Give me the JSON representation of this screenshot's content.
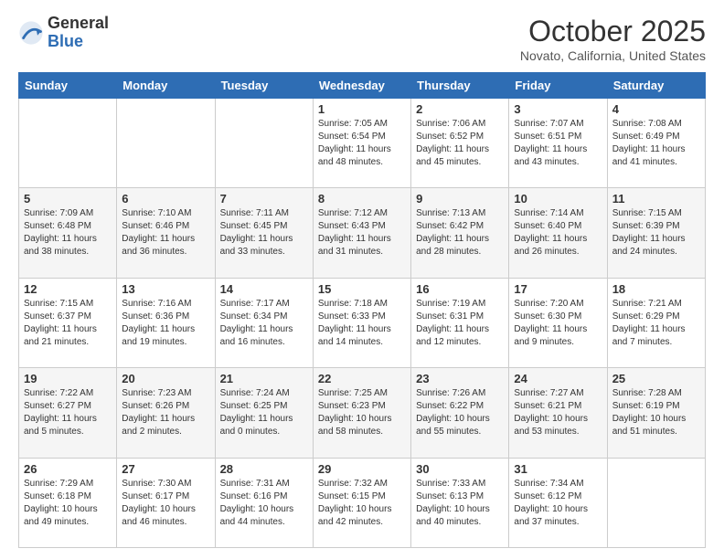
{
  "logo": {
    "general": "General",
    "blue": "Blue"
  },
  "header": {
    "month": "October 2025",
    "location": "Novato, California, United States"
  },
  "days_of_week": [
    "Sunday",
    "Monday",
    "Tuesday",
    "Wednesday",
    "Thursday",
    "Friday",
    "Saturday"
  ],
  "weeks": [
    [
      {
        "day": "",
        "info": ""
      },
      {
        "day": "",
        "info": ""
      },
      {
        "day": "",
        "info": ""
      },
      {
        "day": "1",
        "info": "Sunrise: 7:05 AM\nSunset: 6:54 PM\nDaylight: 11 hours and 48 minutes."
      },
      {
        "day": "2",
        "info": "Sunrise: 7:06 AM\nSunset: 6:52 PM\nDaylight: 11 hours and 45 minutes."
      },
      {
        "day": "3",
        "info": "Sunrise: 7:07 AM\nSunset: 6:51 PM\nDaylight: 11 hours and 43 minutes."
      },
      {
        "day": "4",
        "info": "Sunrise: 7:08 AM\nSunset: 6:49 PM\nDaylight: 11 hours and 41 minutes."
      }
    ],
    [
      {
        "day": "5",
        "info": "Sunrise: 7:09 AM\nSunset: 6:48 PM\nDaylight: 11 hours and 38 minutes."
      },
      {
        "day": "6",
        "info": "Sunrise: 7:10 AM\nSunset: 6:46 PM\nDaylight: 11 hours and 36 minutes."
      },
      {
        "day": "7",
        "info": "Sunrise: 7:11 AM\nSunset: 6:45 PM\nDaylight: 11 hours and 33 minutes."
      },
      {
        "day": "8",
        "info": "Sunrise: 7:12 AM\nSunset: 6:43 PM\nDaylight: 11 hours and 31 minutes."
      },
      {
        "day": "9",
        "info": "Sunrise: 7:13 AM\nSunset: 6:42 PM\nDaylight: 11 hours and 28 minutes."
      },
      {
        "day": "10",
        "info": "Sunrise: 7:14 AM\nSunset: 6:40 PM\nDaylight: 11 hours and 26 minutes."
      },
      {
        "day": "11",
        "info": "Sunrise: 7:15 AM\nSunset: 6:39 PM\nDaylight: 11 hours and 24 minutes."
      }
    ],
    [
      {
        "day": "12",
        "info": "Sunrise: 7:15 AM\nSunset: 6:37 PM\nDaylight: 11 hours and 21 minutes."
      },
      {
        "day": "13",
        "info": "Sunrise: 7:16 AM\nSunset: 6:36 PM\nDaylight: 11 hours and 19 minutes."
      },
      {
        "day": "14",
        "info": "Sunrise: 7:17 AM\nSunset: 6:34 PM\nDaylight: 11 hours and 16 minutes."
      },
      {
        "day": "15",
        "info": "Sunrise: 7:18 AM\nSunset: 6:33 PM\nDaylight: 11 hours and 14 minutes."
      },
      {
        "day": "16",
        "info": "Sunrise: 7:19 AM\nSunset: 6:31 PM\nDaylight: 11 hours and 12 minutes."
      },
      {
        "day": "17",
        "info": "Sunrise: 7:20 AM\nSunset: 6:30 PM\nDaylight: 11 hours and 9 minutes."
      },
      {
        "day": "18",
        "info": "Sunrise: 7:21 AM\nSunset: 6:29 PM\nDaylight: 11 hours and 7 minutes."
      }
    ],
    [
      {
        "day": "19",
        "info": "Sunrise: 7:22 AM\nSunset: 6:27 PM\nDaylight: 11 hours and 5 minutes."
      },
      {
        "day": "20",
        "info": "Sunrise: 7:23 AM\nSunset: 6:26 PM\nDaylight: 11 hours and 2 minutes."
      },
      {
        "day": "21",
        "info": "Sunrise: 7:24 AM\nSunset: 6:25 PM\nDaylight: 11 hours and 0 minutes."
      },
      {
        "day": "22",
        "info": "Sunrise: 7:25 AM\nSunset: 6:23 PM\nDaylight: 10 hours and 58 minutes."
      },
      {
        "day": "23",
        "info": "Sunrise: 7:26 AM\nSunset: 6:22 PM\nDaylight: 10 hours and 55 minutes."
      },
      {
        "day": "24",
        "info": "Sunrise: 7:27 AM\nSunset: 6:21 PM\nDaylight: 10 hours and 53 minutes."
      },
      {
        "day": "25",
        "info": "Sunrise: 7:28 AM\nSunset: 6:19 PM\nDaylight: 10 hours and 51 minutes."
      }
    ],
    [
      {
        "day": "26",
        "info": "Sunrise: 7:29 AM\nSunset: 6:18 PM\nDaylight: 10 hours and 49 minutes."
      },
      {
        "day": "27",
        "info": "Sunrise: 7:30 AM\nSunset: 6:17 PM\nDaylight: 10 hours and 46 minutes."
      },
      {
        "day": "28",
        "info": "Sunrise: 7:31 AM\nSunset: 6:16 PM\nDaylight: 10 hours and 44 minutes."
      },
      {
        "day": "29",
        "info": "Sunrise: 7:32 AM\nSunset: 6:15 PM\nDaylight: 10 hours and 42 minutes."
      },
      {
        "day": "30",
        "info": "Sunrise: 7:33 AM\nSunset: 6:13 PM\nDaylight: 10 hours and 40 minutes."
      },
      {
        "day": "31",
        "info": "Sunrise: 7:34 AM\nSunset: 6:12 PM\nDaylight: 10 hours and 37 minutes."
      },
      {
        "day": "",
        "info": ""
      }
    ]
  ]
}
